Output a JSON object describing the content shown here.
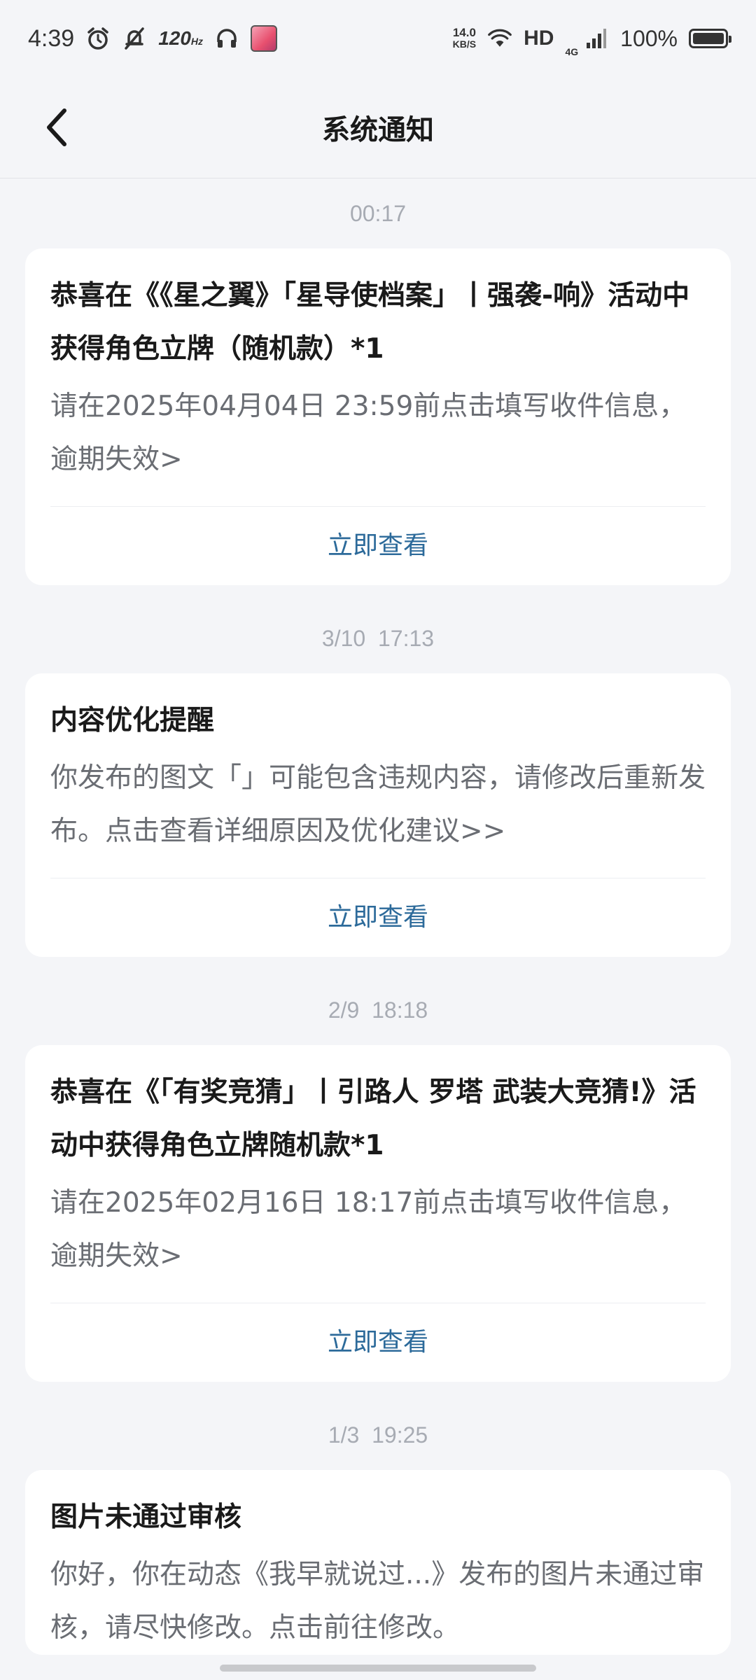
{
  "status_bar": {
    "time": "4:39",
    "refresh_rate": "120",
    "refresh_unit": "Hz",
    "net_speed_value": "14.0",
    "net_speed_unit": "KB/S",
    "hd": "HD",
    "network": "4G",
    "battery_text": "100%",
    "battery_level": 1.0
  },
  "header": {
    "title": "系统通知",
    "back_icon": "chevron-left-icon"
  },
  "notifications": [
    {
      "time": "00:17",
      "title": "恭喜在《《星之翼》「星导使档案」丨强袭-响》活动中获得角色立牌（随机款）*1",
      "body": "请在2025年04月04日 23:59前点击填写收件信息，逾期失效>",
      "action": "立即查看"
    },
    {
      "time": "3/10  17:13",
      "title": "内容优化提醒",
      "body": "你发布的图文「」可能包含违规内容，请修改后重新发布。点击查看详细原因及优化建议>>",
      "action": "立即查看"
    },
    {
      "time": "2/9  18:18",
      "title": "恭喜在《「有奖竞猜」丨引路人 罗塔 武装大竞猜!》活动中获得角色立牌随机款*1",
      "body": "请在2025年02月16日 18:17前点击填写收件信息，逾期失效>",
      "action": "立即查看"
    },
    {
      "time": "1/3  19:25",
      "title": "图片未通过审核",
      "body": "你好，你在动态《我早就说过...》发布的图片未通过审核，请尽快修改。点击前往修改。"
    }
  ]
}
